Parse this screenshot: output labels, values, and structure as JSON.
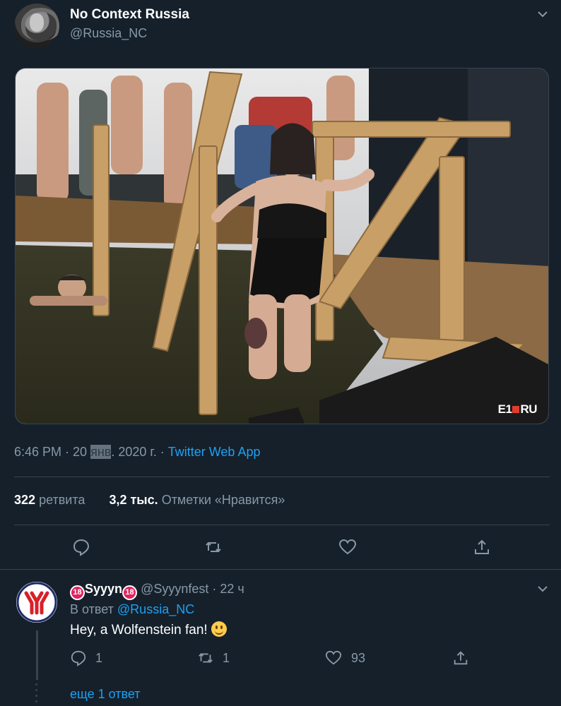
{
  "tweet": {
    "author_name": "No Context Russia",
    "author_handle": "@Russia_NC",
    "image_watermark": "E1■RU",
    "time": "6:46 PM",
    "date_prefix": " · 20 ",
    "date_month": "янв",
    "date_suffix": ". 2020 г.",
    "client_sep": " · ",
    "client": "Twitter Web App",
    "retweets_count": "322",
    "retweets_label": "ретвита",
    "likes_count": "3,2 тыс.",
    "likes_label": "Отметки «Нравится»",
    "actions": [
      "reply-icon",
      "retweet-icon",
      "like-icon",
      "share-icon"
    ]
  },
  "reply": {
    "badge": "18",
    "author_name": "Syyyn",
    "author_handle": "@Syyynfest",
    "time": "· 22 ч",
    "reply_to_prefix": "В ответ",
    "reply_to_handle": "@Russia_NC",
    "text": "Hey, a Wolfenstein fan!",
    "reply_count": "1",
    "retweet_count": "1",
    "like_count": "93",
    "more_replies": "еще 1 ответ"
  },
  "colors": {
    "background": "#15202b",
    "muted": "#8899a6",
    "link": "#1da1f2",
    "separator": "#38444d"
  }
}
